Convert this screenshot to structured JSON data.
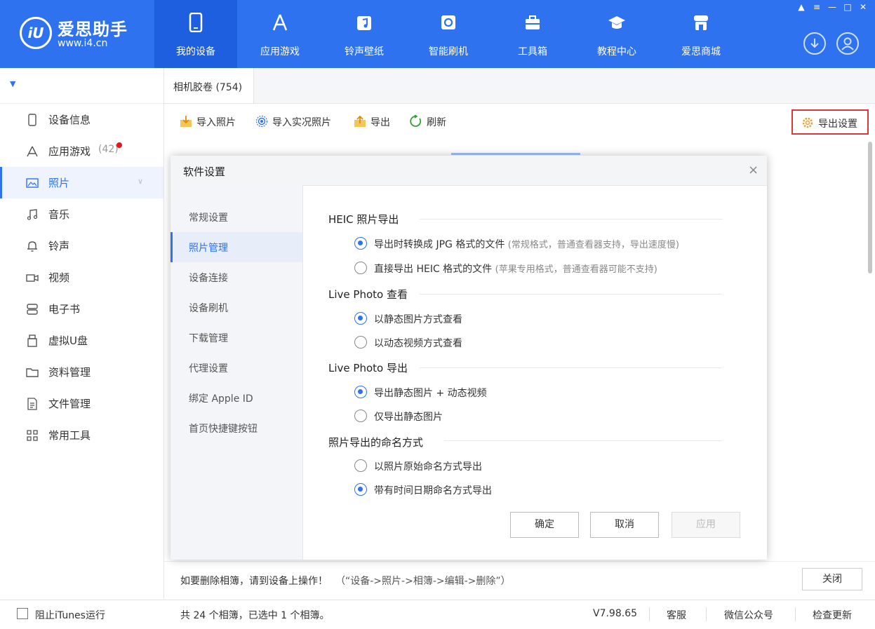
{
  "app": {
    "brand_name": "爱思助手",
    "brand_url": "www.i4.cn",
    "brand_mark": "iU",
    "accent": "#2f72ef"
  },
  "topnav": [
    {
      "label": "我的设备",
      "icon": "phone-icon"
    },
    {
      "label": "应用游戏",
      "icon": "app-store-icon"
    },
    {
      "label": "铃声壁纸",
      "icon": "music-icon"
    },
    {
      "label": "智能刷机",
      "icon": "refresh-icon"
    },
    {
      "label": "工具箱",
      "icon": "toolbox-icon"
    },
    {
      "label": "教程中心",
      "icon": "graduation-cap-icon"
    },
    {
      "label": "爱思商城",
      "icon": "shop-icon"
    }
  ],
  "sidebar": {
    "items": [
      {
        "label": "设备信息",
        "icon": "device-icon"
      },
      {
        "label": "应用游戏",
        "count": "(42)",
        "icon": "app-icon"
      },
      {
        "label": "照片",
        "icon": "photo-icon"
      },
      {
        "label": "音乐",
        "icon": "music-note-icon"
      },
      {
        "label": "铃声",
        "icon": "bell-icon"
      },
      {
        "label": "视频",
        "icon": "video-icon"
      },
      {
        "label": "电子书",
        "icon": "book-icon"
      },
      {
        "label": "虚拟U盘",
        "icon": "usb-icon"
      },
      {
        "label": "资料管理",
        "icon": "folder-icon"
      },
      {
        "label": "文件管理",
        "icon": "file-icon"
      },
      {
        "label": "常用工具",
        "icon": "grid-icon"
      }
    ]
  },
  "tab": {
    "label": "相机胶卷 (754)"
  },
  "toolbar": {
    "import_photos": "导入照片",
    "import_live": "导入实况照片",
    "export": "导出",
    "refresh": "刷新",
    "export_settings": "导出设置"
  },
  "dialog": {
    "title": "软件设置",
    "close": "×",
    "nav": [
      "常规设置",
      "照片管理",
      "设备连接",
      "设备刷机",
      "下载管理",
      "代理设置",
      "绑定 Apple ID",
      "首页快捷键按钮"
    ],
    "sections": [
      {
        "title": "HEIC 照片导出",
        "options": [
          {
            "label": "导出时转换成 JPG 格式的文件",
            "hint": "(常规格式，普通查看器支持，导出速度慢)",
            "checked": true
          },
          {
            "label": "直接导出 HEIC 格式的文件",
            "hint": "(苹果专用格式，普通查看器可能不支持)",
            "checked": false
          }
        ]
      },
      {
        "title": "Live Photo 查看",
        "options": [
          {
            "label": "以静态图片方式查看",
            "hint": "",
            "checked": true
          },
          {
            "label": "以动态视频方式查看",
            "hint": "",
            "checked": false
          }
        ]
      },
      {
        "title": "Live Photo 导出",
        "options": [
          {
            "label": "导出静态图片 + 动态视频",
            "hint": "",
            "checked": true
          },
          {
            "label": "仅导出静态图片",
            "hint": "",
            "checked": false
          }
        ]
      },
      {
        "title": "照片导出的命名方式",
        "options": [
          {
            "label": "以照片原始命名方式导出",
            "hint": "",
            "checked": false
          },
          {
            "label": "带有时间日期命名方式导出",
            "hint": "",
            "checked": true
          }
        ]
      }
    ],
    "buttons": {
      "ok": "确定",
      "cancel": "取消",
      "apply": "应用"
    }
  },
  "bottom": {
    "notice": "如要删除相簿，请到设备上操作！",
    "notice_path": "（“设备->照片->相簿->编辑->删除”）",
    "close": "关闭"
  },
  "status": {
    "block_itunes": "阻止iTunes运行",
    "summary": "共 24 个相簿，已选中 1 个相簿。",
    "version": "V7.98.65",
    "service": "客服",
    "wechat": "微信公众号",
    "check_update": "检查更新"
  }
}
